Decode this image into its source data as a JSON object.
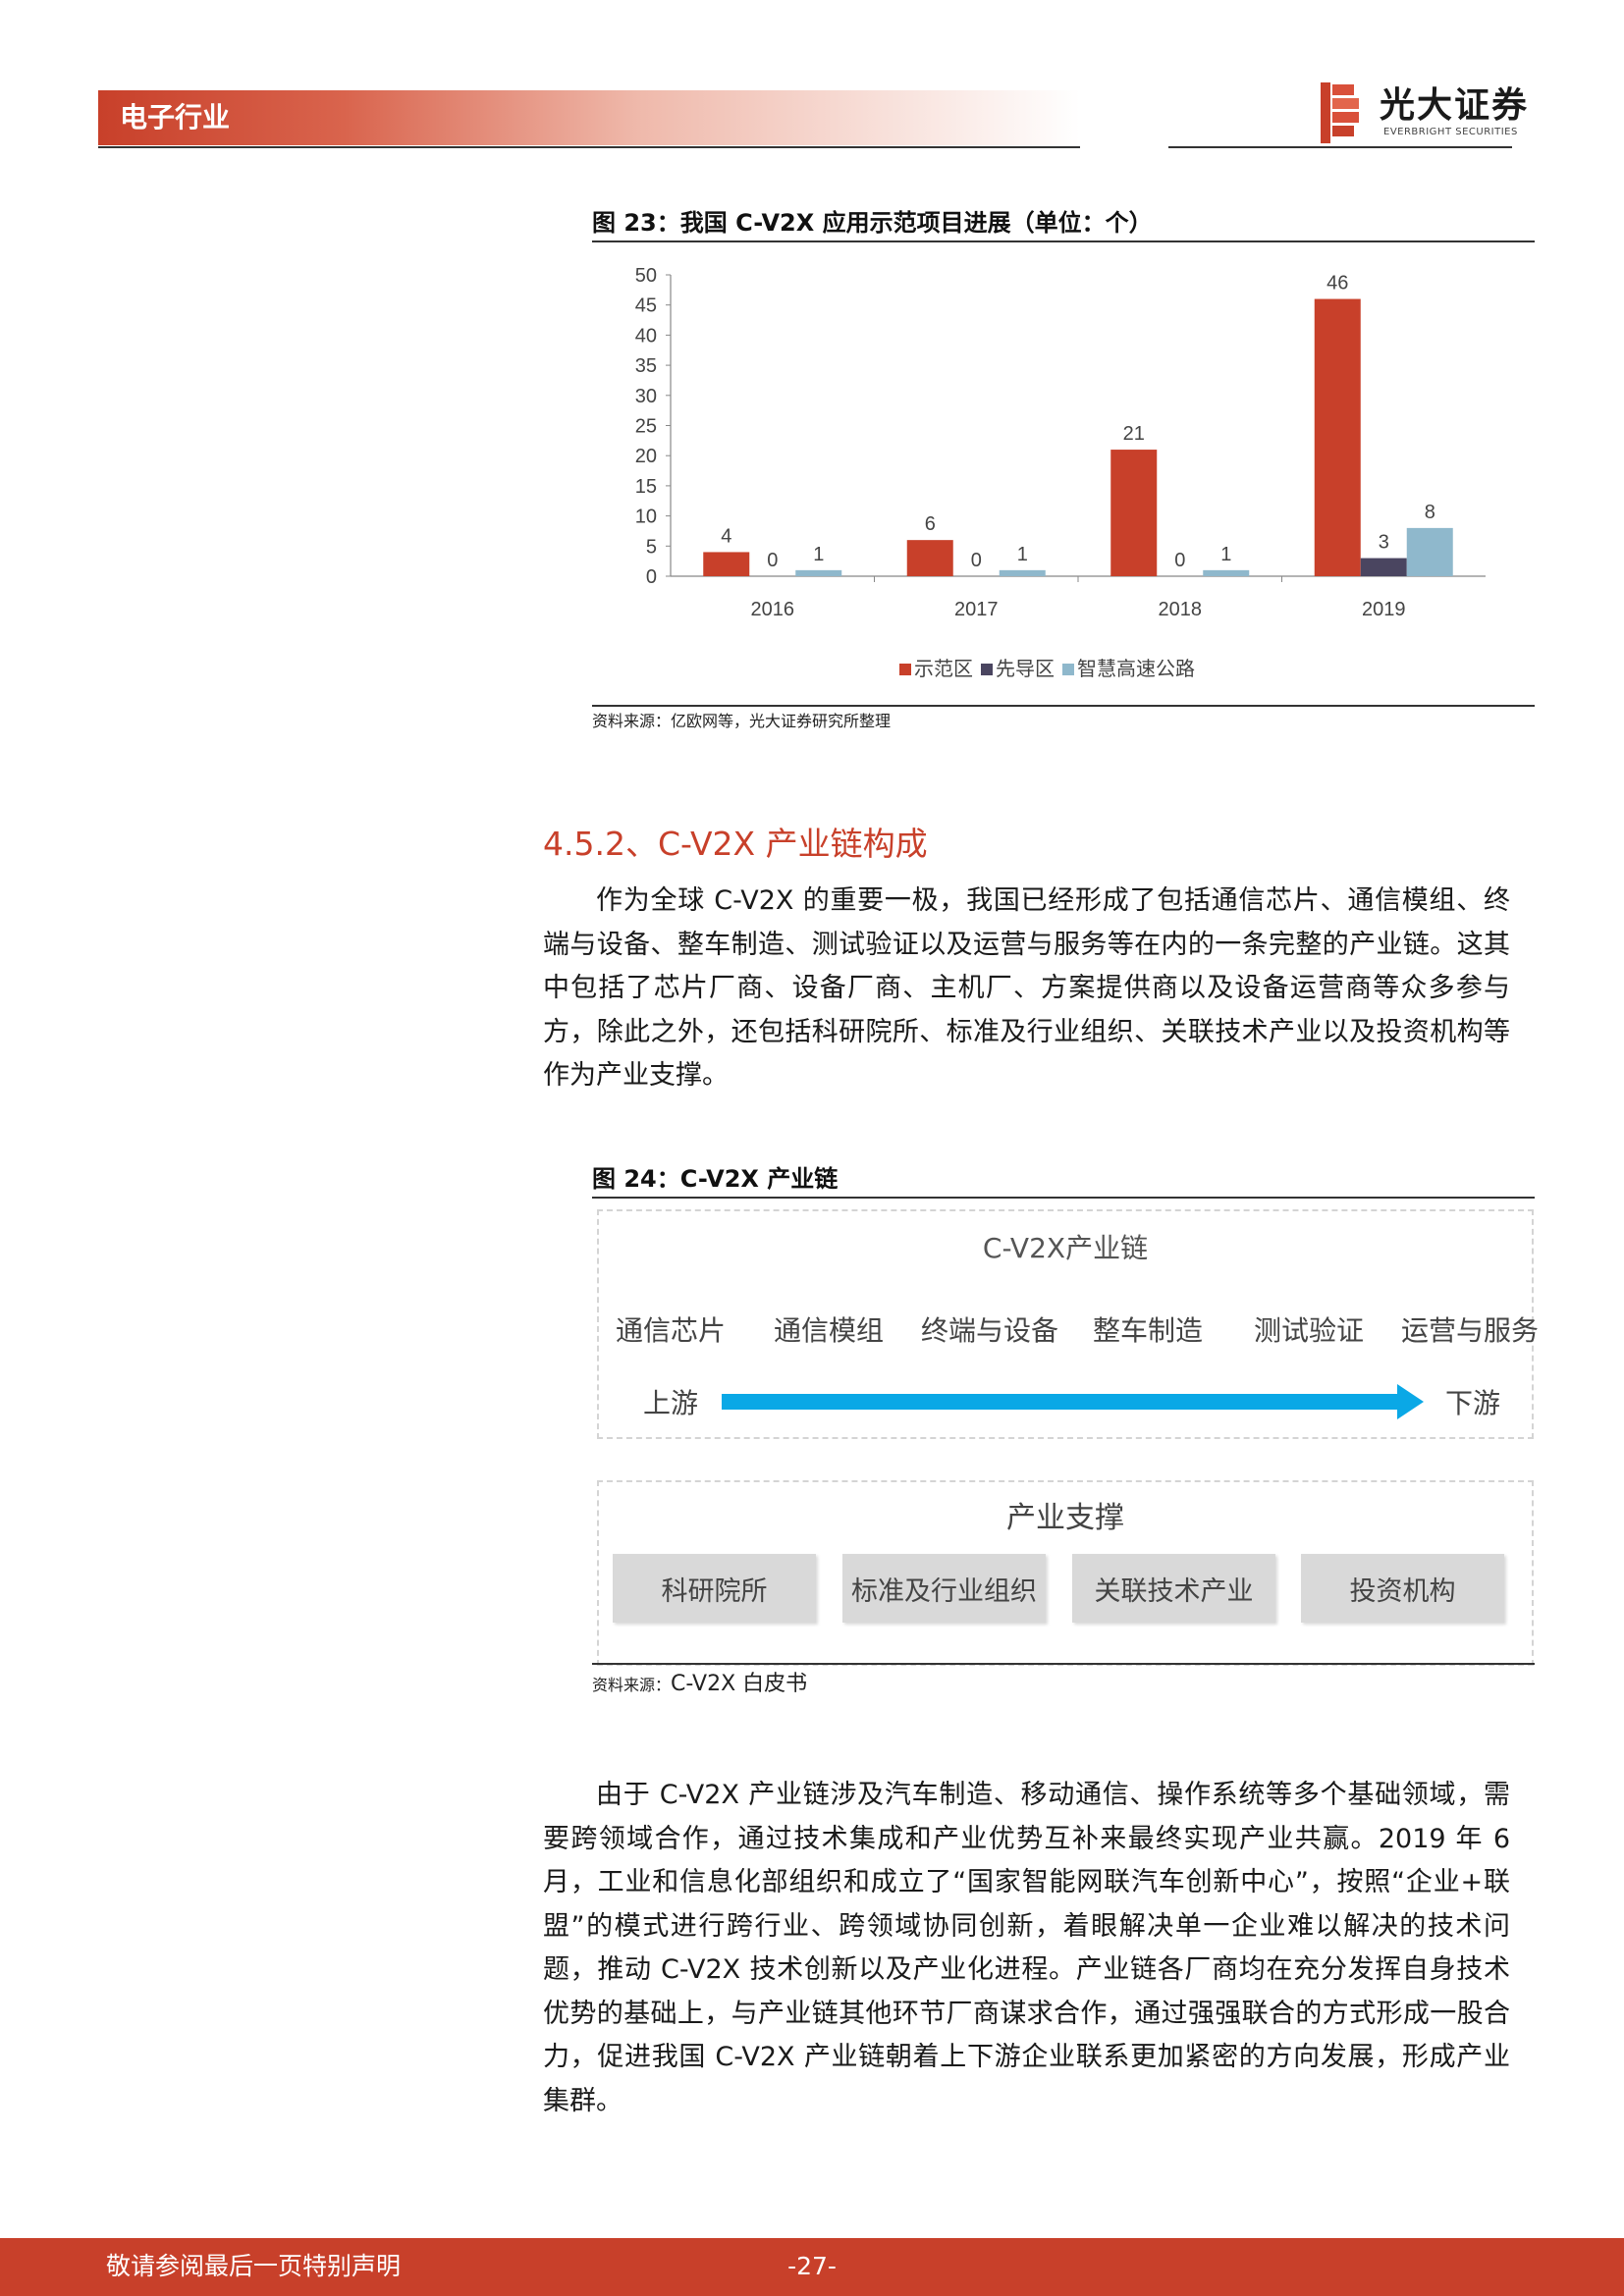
{
  "header": {
    "section": "电子行业",
    "brand_cn": "光大证券",
    "brand_en": "EVERBRIGHT SECURITIES",
    "brand_color": "#c8402a"
  },
  "figure23": {
    "title": "图 23：我国 C-V2X 应用示范项目进展（单位：个）",
    "source": "资料来源：亿欧网等，光大证券研究所整理",
    "chart_data": {
      "type": "bar",
      "categories": [
        "2016",
        "2017",
        "2018",
        "2019"
      ],
      "series": [
        {
          "name": "示范区",
          "values": [
            4,
            6,
            21,
            46
          ],
          "color": "#c8402a"
        },
        {
          "name": "先导区",
          "values": [
            0,
            0,
            0,
            3
          ],
          "color": "#4a4560"
        },
        {
          "name": "智慧高速公路",
          "values": [
            1,
            1,
            1,
            8
          ],
          "color": "#8fb8cc"
        }
      ],
      "yticks": [
        "0",
        "5",
        "10",
        "15",
        "20",
        "25",
        "30",
        "35",
        "40",
        "45",
        "50"
      ],
      "ylim": [
        0,
        50
      ],
      "grid": false,
      "legend": "bottom"
    }
  },
  "section": {
    "heading": "4.5.2、C-V2X 产业链构成",
    "para1": "作为全球 C-V2X 的重要一极，我国已经形成了包括通信芯片、通信模组、终端与设备、整车制造、测试验证以及运营与服务等在内的一条完整的产业链。这其中包括了芯片厂商、设备厂商、主机厂、方案提供商以及设备运营商等众多参与方，除此之外，还包括科研院所、标准及行业组织、关联技术产业以及投资机构等作为产业支撑。"
  },
  "figure24": {
    "title": "图 24：C-V2X 产业链",
    "chain_title": "C-V2X产业链",
    "stages": [
      "通信芯片",
      "通信模组",
      "终端与设备",
      "整车制造",
      "测试验证",
      "运营与服务"
    ],
    "upstream": "上游",
    "downstream": "下游",
    "arrow_color": "#0aa8e6",
    "support_title": "产业支撑",
    "support_items": [
      "科研院所",
      "标准及行业组织",
      "关联技术产业",
      "投资机构"
    ],
    "source_prefix": "资料来源：",
    "source_text": "C-V2X 白皮书"
  },
  "para2": "由于 C-V2X 产业链涉及汽车制造、移动通信、操作系统等多个基础领域，需要跨领域合作，通过技术集成和产业优势互补来最终实现产业共赢。2019 年 6 月，工业和信息化部组织和成立了“国家智能网联汽车创新中心”，按照“企业+联盟”的模式进行跨行业、跨领域协同创新，着眼解决单一企业难以解决的技术问题，推动 C-V2X 技术创新以及产业化进程。产业链各厂商均在充分发挥自身技术优势的基础上，与产业链其他环节厂商谋求合作，通过强强联合的方式形成一股合力，促进我国 C-V2X 产业链朝着上下游企业联系更加紧密的方向发展，形成产业集群。",
  "footer": {
    "note": "敬请参阅最后一页特别声明",
    "page": "-27-"
  }
}
